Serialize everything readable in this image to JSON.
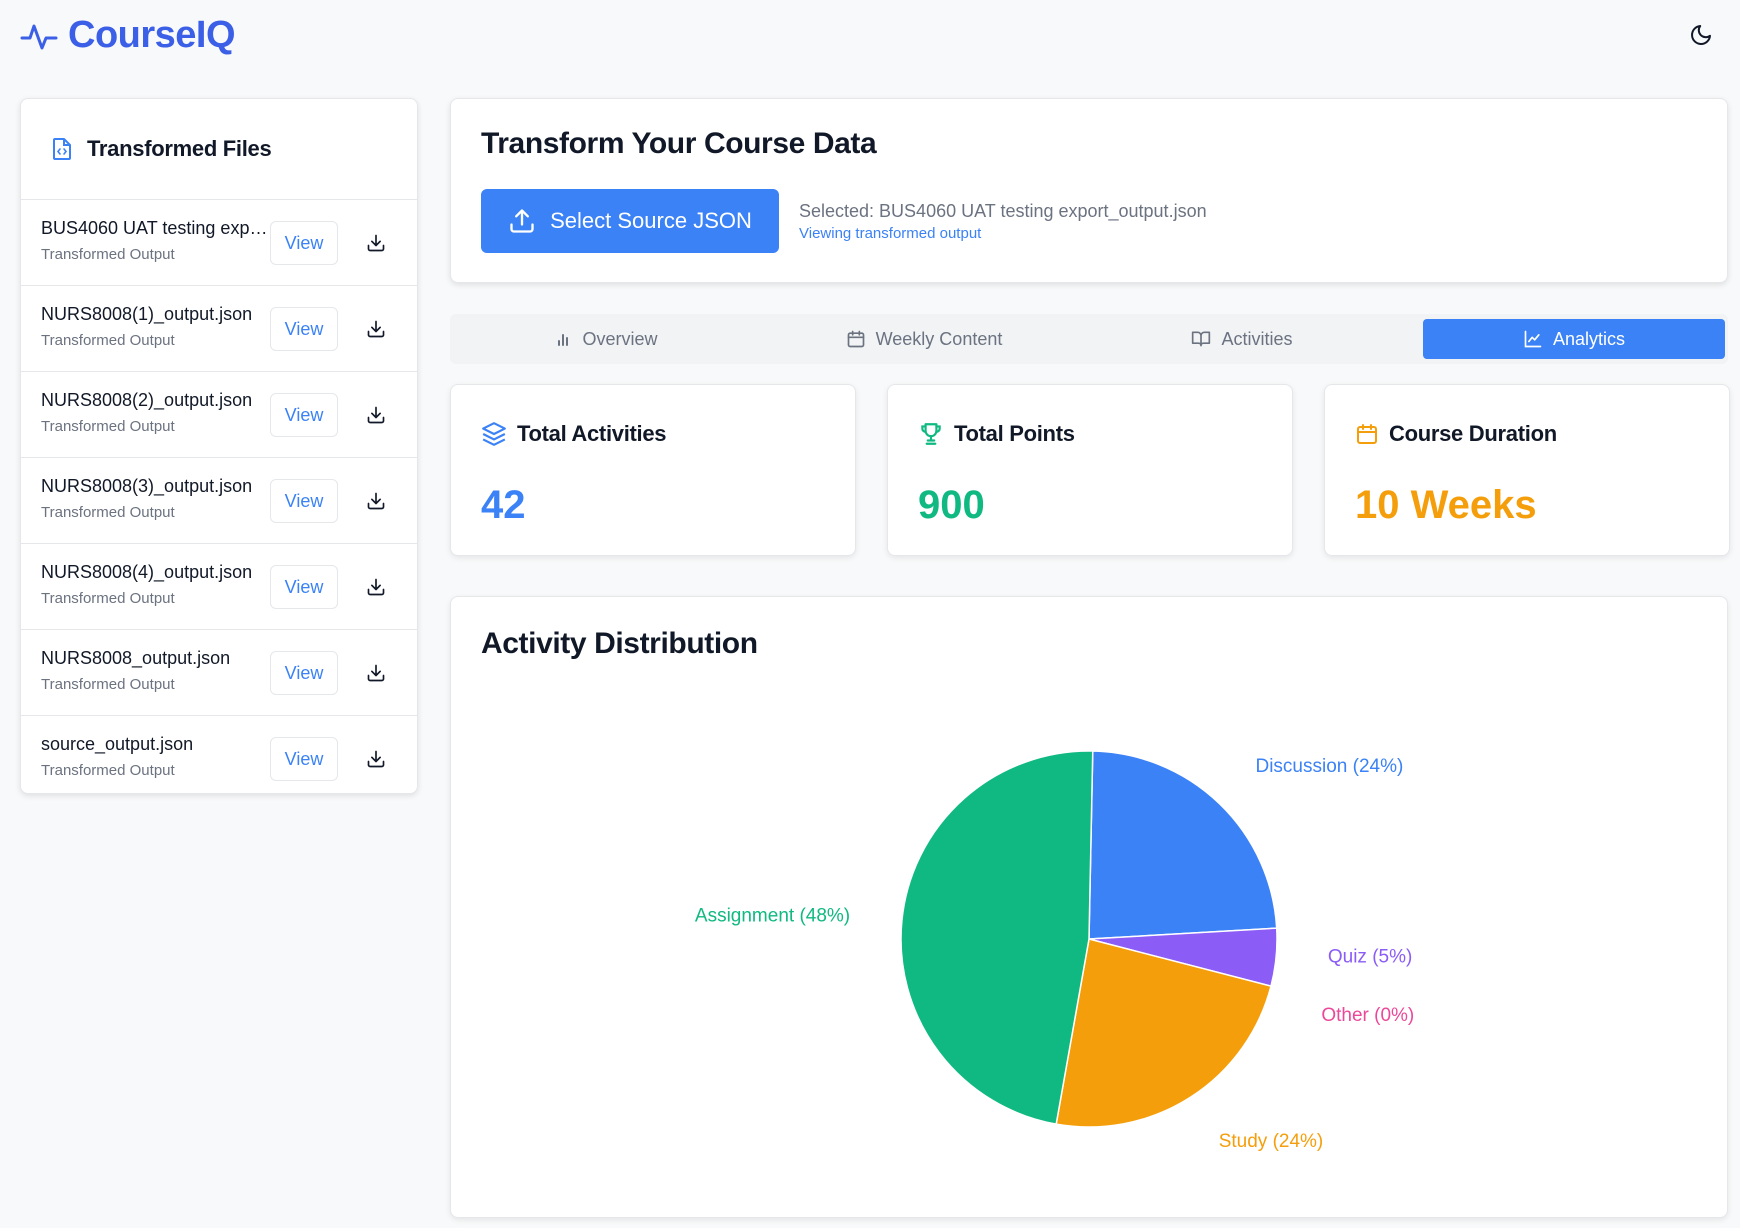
{
  "app": {
    "name": "CourseIQ"
  },
  "header": {
    "theme_icon": "moon-icon"
  },
  "sidebar": {
    "title": "Transformed Files",
    "title_icon": "file-code-icon",
    "files": [
      {
        "name": "BUS4060 UAT testing export_output.json",
        "subtitle": "Transformed Output",
        "view_label": "View"
      },
      {
        "name": "NURS8008(1)_output.json",
        "subtitle": "Transformed Output",
        "view_label": "View"
      },
      {
        "name": "NURS8008(2)_output.json",
        "subtitle": "Transformed Output",
        "view_label": "View"
      },
      {
        "name": "NURS8008(3)_output.json",
        "subtitle": "Transformed Output",
        "view_label": "View"
      },
      {
        "name": "NURS8008(4)_output.json",
        "subtitle": "Transformed Output",
        "view_label": "View"
      },
      {
        "name": "NURS8008_output.json",
        "subtitle": "Transformed Output",
        "view_label": "View"
      },
      {
        "name": "source_output.json",
        "subtitle": "Transformed Output",
        "view_label": "View"
      }
    ]
  },
  "transform": {
    "title": "Transform Your Course Data",
    "select_label": "Select Source JSON",
    "selected_text": "Selected: BUS4060 UAT testing export_output.json",
    "viewing_text": "Viewing transformed output"
  },
  "tabs": [
    {
      "label": "Overview",
      "icon": "bar-chart-icon",
      "active": false
    },
    {
      "label": "Weekly Content",
      "icon": "calendar-icon",
      "active": false
    },
    {
      "label": "Activities",
      "icon": "book-open-icon",
      "active": false
    },
    {
      "label": "Analytics",
      "icon": "line-chart-icon",
      "active": true
    }
  ],
  "stats": [
    {
      "label": "Total Activities",
      "value": "42",
      "icon": "layers-icon",
      "color": "#3b82f6"
    },
    {
      "label": "Total Points",
      "value": "900",
      "icon": "trophy-icon",
      "color": "#10b981"
    },
    {
      "label": "Course Duration",
      "value": "10 Weeks",
      "icon": "calendar-icon",
      "color": "#f59e0b"
    }
  ],
  "distribution": {
    "title": "Activity Distribution"
  },
  "chart_data": {
    "type": "pie",
    "slices": [
      {
        "label": "Discussion (24%)",
        "value": 24,
        "color": "#3b82f6"
      },
      {
        "label": "Quiz (5%)",
        "value": 5,
        "color": "#8b5cf6"
      },
      {
        "label": "Other (0%)",
        "value": 0,
        "color": "#ec4899"
      },
      {
        "label": "Study (24%)",
        "value": 24,
        "color": "#f59e0b"
      },
      {
        "label": "Assignment (48%)",
        "value": 48,
        "color": "#10b981"
      }
    ]
  }
}
